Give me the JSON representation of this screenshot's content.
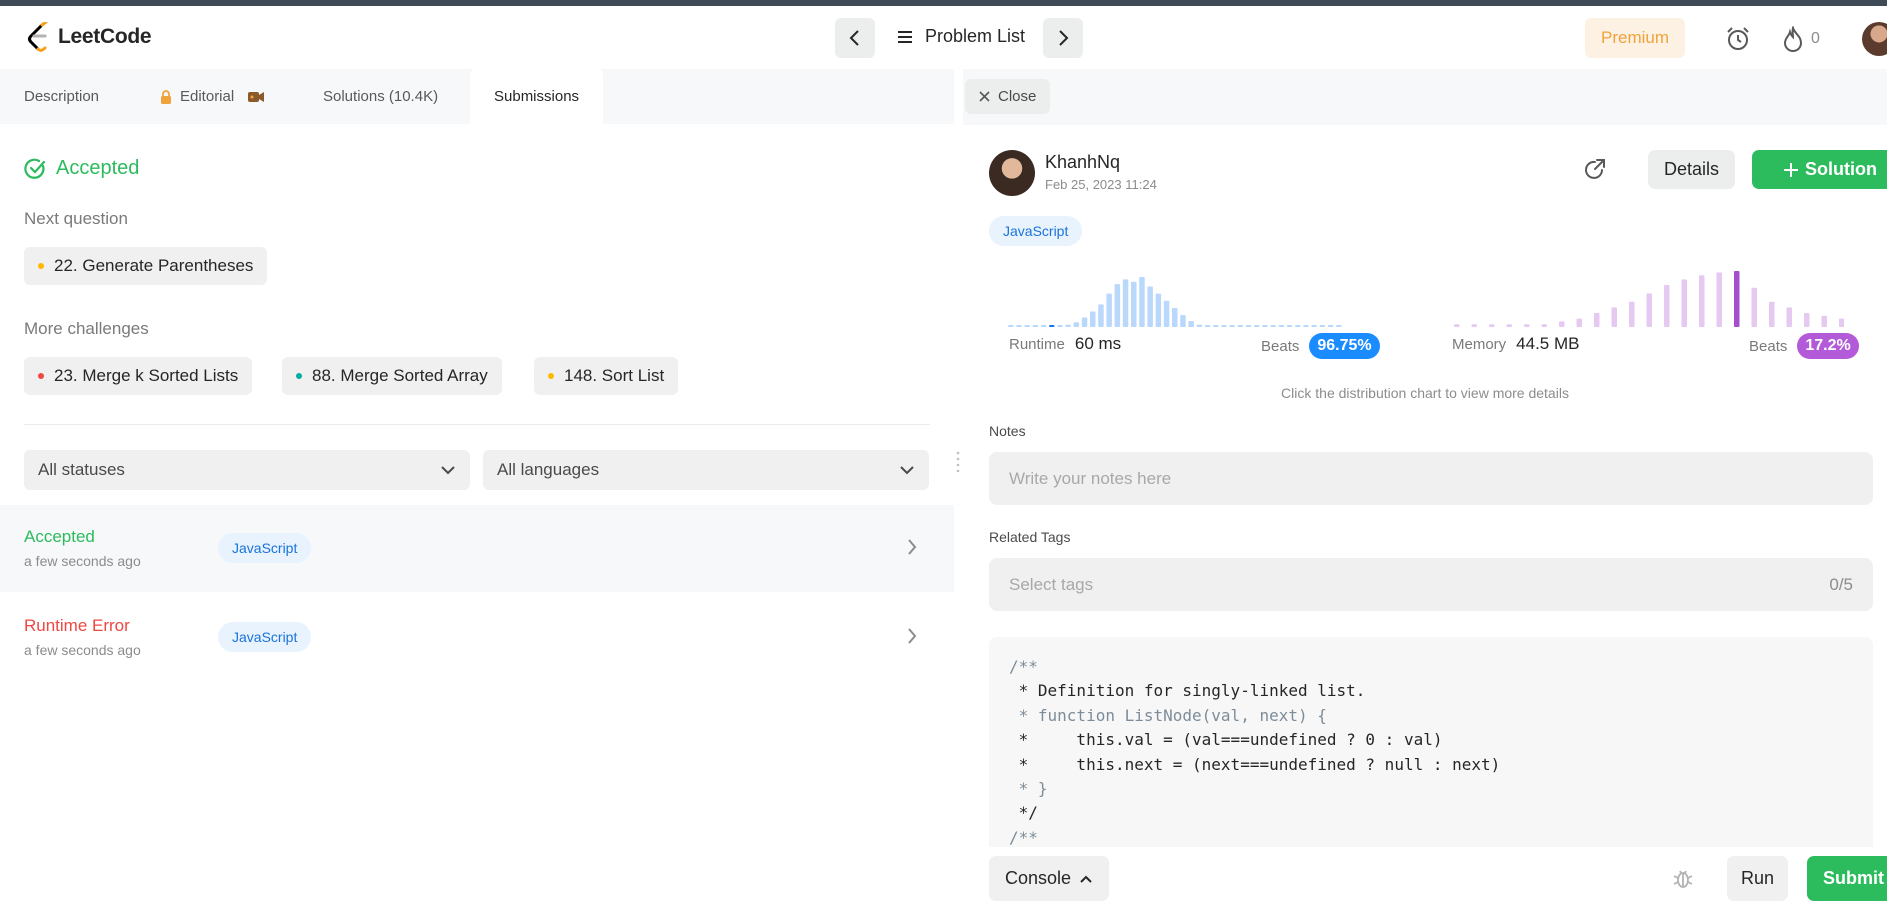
{
  "app": {
    "name": "LeetCode"
  },
  "nav": {
    "problem_list": "Problem List",
    "premium": "Premium",
    "streak_count": "0"
  },
  "tabs": [
    {
      "label": "Description"
    },
    {
      "label": "Editorial"
    },
    {
      "label": "Solutions (10.4K)"
    },
    {
      "label": "Submissions"
    }
  ],
  "result": {
    "status": "Accepted",
    "next_label": "Next question",
    "next_question": {
      "label": "22. Generate Parentheses",
      "difficulty_color": "#ffb800"
    },
    "more_label": "More challenges",
    "challenges": [
      {
        "label": "23. Merge k Sorted Lists",
        "difficulty_color": "#ef4743"
      },
      {
        "label": "88. Merge Sorted Array",
        "difficulty_color": "#00af9b"
      },
      {
        "label": "148. Sort List",
        "difficulty_color": "#ffb800"
      }
    ]
  },
  "filters": {
    "status": "All statuses",
    "language": "All languages"
  },
  "submissions": [
    {
      "status": "Accepted",
      "time": "a few seconds ago",
      "lang": "JavaScript",
      "color": "#2cbb5d"
    },
    {
      "status": "Runtime Error",
      "time": "a few seconds ago",
      "lang": "JavaScript",
      "color": "#ef4743"
    }
  ],
  "detail": {
    "close": "Close",
    "user": "KhanhNq",
    "date": "Feb 25, 2023 11:24",
    "details_btn": "Details",
    "solution_btn": "Solution",
    "language": "JavaScript",
    "runtime_label": "Runtime",
    "runtime_value": "60 ms",
    "runtime_beats": "96.75%",
    "memory_label": "Memory",
    "memory_value": "44.5 MB",
    "memory_beats": "17.2%",
    "beats_label": "Beats",
    "hint": "Click the distribution chart to view more details",
    "notes_label": "Notes",
    "notes_placeholder": "Write your notes here",
    "tags_label": "Related Tags",
    "tags_placeholder": "Select tags",
    "tags_count": "0/5",
    "code_lines": [
      "/**",
      " * Definition for singly-linked list.",
      " * function ListNode(val, next) {",
      " *     this.val = (val===undefined ? 0 : val)",
      " *     this.next = (next===undefined ? null : next)",
      " * }",
      " */",
      "/**"
    ],
    "console": "Console",
    "run": "Run",
    "submit": "Submit"
  },
  "colors": {
    "green": "#2cbb5d",
    "blue": "#1a73d9",
    "purple": "#b25ad8",
    "premium": "#f0a33a"
  },
  "chart_data": [
    {
      "type": "bar",
      "title": "Runtime",
      "highlight_index": 5,
      "values": [
        1,
        1,
        1,
        1,
        1,
        1,
        1,
        2,
        4,
        8,
        13,
        19,
        28,
        36,
        40,
        38,
        42,
        34,
        28,
        22,
        16,
        10,
        5,
        2,
        1,
        1,
        1,
        1,
        1,
        1,
        1,
        1,
        1,
        1,
        1,
        1,
        1,
        1,
        1,
        1,
        1
      ]
    },
    {
      "type": "bar",
      "title": "Memory",
      "highlight_index": 16,
      "values": [
        2,
        2,
        2,
        2,
        2,
        2,
        4,
        6,
        10,
        14,
        18,
        24,
        30,
        34,
        37,
        39,
        40,
        28,
        18,
        14,
        10,
        8,
        6
      ]
    }
  ]
}
